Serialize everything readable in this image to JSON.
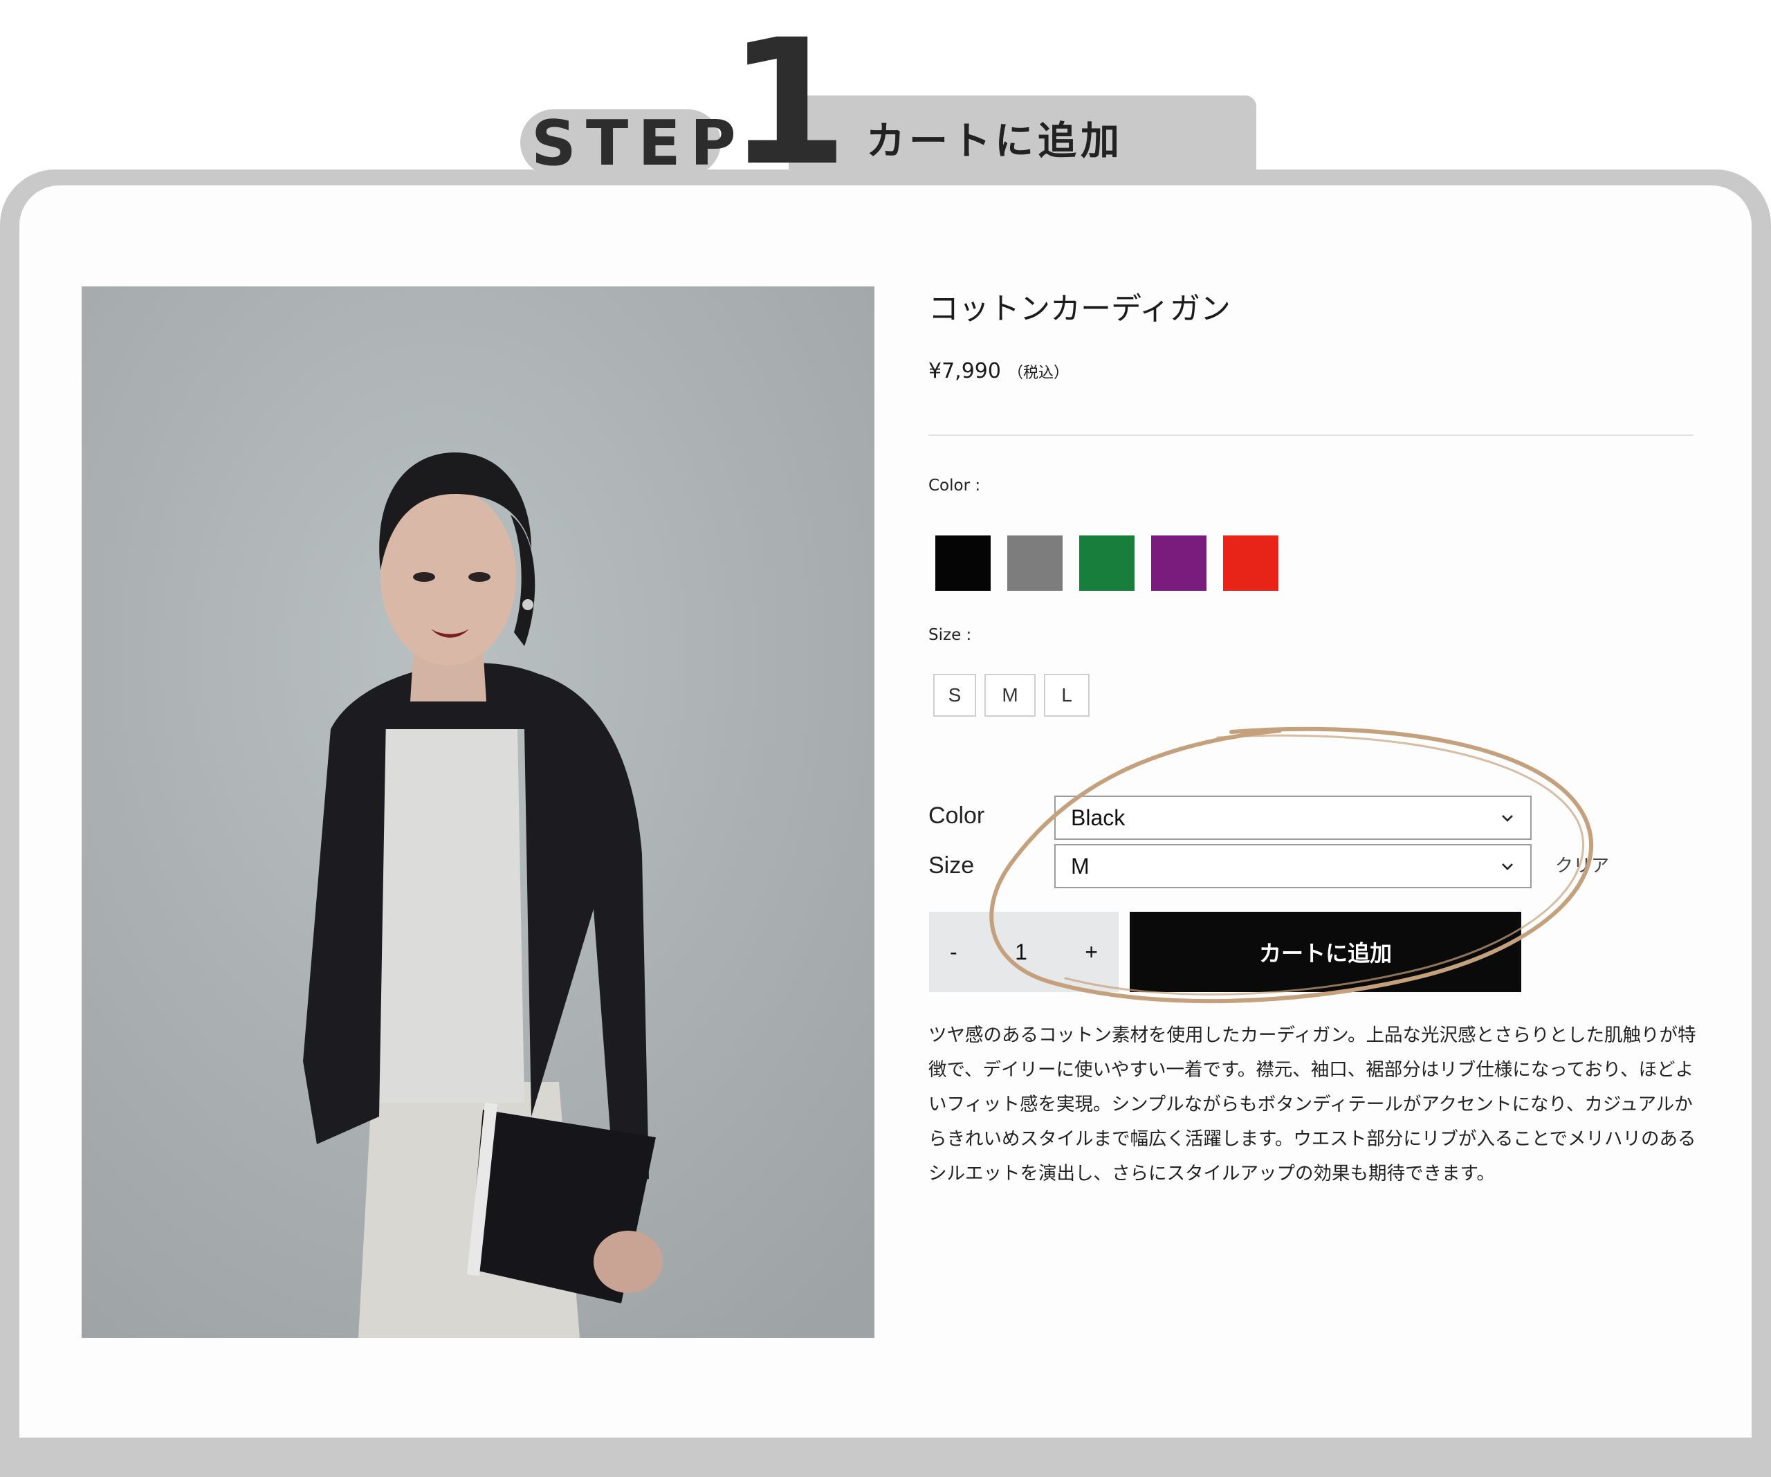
{
  "step": {
    "label": "STEP",
    "number": "1",
    "title": "カートに追加"
  },
  "product": {
    "title": "コットンカーディガン",
    "price": "¥7,990",
    "tax_note": "（税込）",
    "description": "ツヤ感のあるコットン素材を使用したカーディガン。上品な光沢感とさらりとした肌触りが特徴で、デイリーに使いやすい一着です。襟元、袖口、裾部分はリブ仕様になっており、ほどよいフィット感を実現。シンプルながらもボタンディテールがアクセントになり、カジュアルからきれいめスタイルまで幅広く活躍します。ウエスト部分にリブが入ることでメリハリのあるシルエットを演出し、さらにスタイルアップの効果も期待できます。"
  },
  "color_section": {
    "label": "Color :",
    "swatches": [
      "#050505",
      "#7d7d7d",
      "#177f3b",
      "#7a1c7e",
      "#e82419"
    ]
  },
  "size_section": {
    "label": "Size :",
    "options": [
      "S",
      "M",
      "L"
    ]
  },
  "variant_form": {
    "color_label": "Color",
    "color_value": "Black",
    "size_label": "Size",
    "size_value": "M",
    "clear_label": "クリア"
  },
  "quantity": {
    "minus": "-",
    "value": "1",
    "plus": "+"
  },
  "cart_button": "カートに追加",
  "colors": {
    "frame": "#c9c9c9",
    "highlight_circle": "#c4a17c",
    "button": "#0a0a0a"
  }
}
